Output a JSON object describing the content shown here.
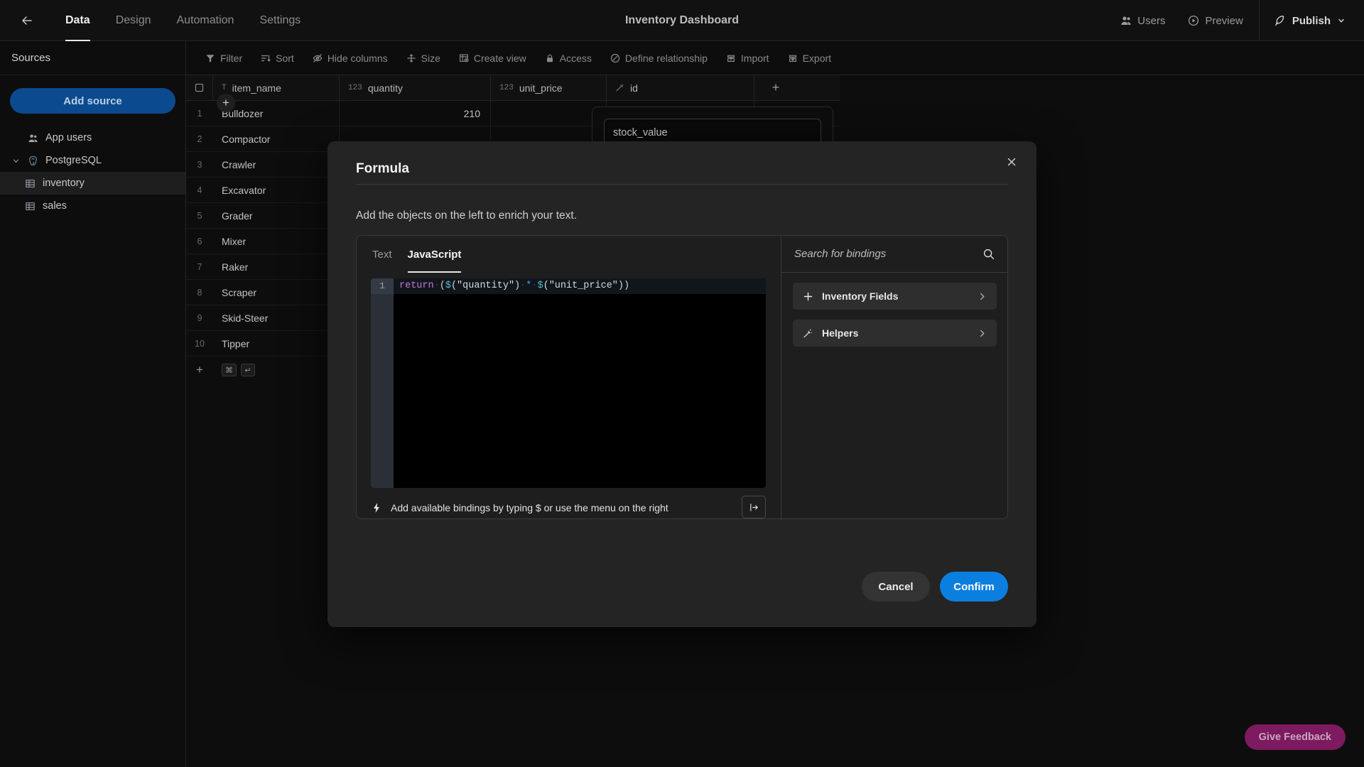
{
  "header": {
    "back_icon": "arrow-left-icon",
    "tabs": [
      {
        "label": "Data",
        "active": true
      },
      {
        "label": "Design",
        "active": false
      },
      {
        "label": "Automation",
        "active": false
      },
      {
        "label": "Settings",
        "active": false
      }
    ],
    "title": "Inventory Dashboard",
    "users_label": "Users",
    "preview_label": "Preview",
    "publish_label": "Publish"
  },
  "sidebar": {
    "section_label": "Sources",
    "add_source_label": "Add source",
    "items": [
      {
        "label": "App users",
        "icon": "users-icon",
        "selected": false
      },
      {
        "label": "PostgreSQL",
        "icon": "postgres-icon",
        "selected": false
      },
      {
        "label": "inventory",
        "icon": "table-icon",
        "selected": true
      },
      {
        "label": "sales",
        "icon": "table-icon",
        "selected": false
      }
    ]
  },
  "toolbar": {
    "items": [
      {
        "label": "Filter",
        "icon": "filter-icon"
      },
      {
        "label": "Sort",
        "icon": "sort-icon"
      },
      {
        "label": "Hide columns",
        "icon": "eye-off-icon"
      },
      {
        "label": "Size",
        "icon": "row-height-icon"
      },
      {
        "label": "Create view",
        "icon": "create-view-icon"
      },
      {
        "label": "Access",
        "icon": "lock-icon"
      },
      {
        "label": "Define relationship",
        "icon": "relationship-icon"
      },
      {
        "label": "Import",
        "icon": "import-icon"
      },
      {
        "label": "Export",
        "icon": "export-icon"
      }
    ]
  },
  "grid": {
    "columns": [
      {
        "label": "item_name",
        "type_icon": "text-icon",
        "type_glyph": "T"
      },
      {
        "label": "quantity",
        "type_icon": "number-icon",
        "type_glyph": "123"
      },
      {
        "label": "unit_price",
        "type_icon": "number-icon",
        "type_glyph": "123"
      },
      {
        "label": "id",
        "type_icon": "formula-icon",
        "type_glyph": ""
      }
    ],
    "add_column_label": "+",
    "rows": [
      {
        "index": "1",
        "item_name": "Bulldozer",
        "quantity": "210",
        "unit_price": "",
        "id": ""
      },
      {
        "index": "2",
        "item_name": "Compactor",
        "quantity": "",
        "unit_price": "",
        "id": ""
      },
      {
        "index": "3",
        "item_name": "Crawler",
        "quantity": "",
        "unit_price": "",
        "id": ""
      },
      {
        "index": "4",
        "item_name": "Excavator",
        "quantity": "",
        "unit_price": "",
        "id": ""
      },
      {
        "index": "5",
        "item_name": "Grader",
        "quantity": "",
        "unit_price": "",
        "id": ""
      },
      {
        "index": "6",
        "item_name": "Mixer",
        "quantity": "",
        "unit_price": "",
        "id": ""
      },
      {
        "index": "7",
        "item_name": "Raker",
        "quantity": "",
        "unit_price": "",
        "id": ""
      },
      {
        "index": "8",
        "item_name": "Scraper",
        "quantity": "",
        "unit_price": "",
        "id": ""
      },
      {
        "index": "9",
        "item_name": "Skid-Steer",
        "quantity": "",
        "unit_price": "",
        "id": ""
      },
      {
        "index": "10",
        "item_name": "Tipper",
        "quantity": "",
        "unit_price": "",
        "id": ""
      }
    ],
    "new_row": {
      "plus": "+",
      "kbd_cmd": "⌘",
      "kbd_enter": "↵"
    }
  },
  "column_popover": {
    "name_value": "stock_value"
  },
  "modal": {
    "title": "Formula",
    "close_icon": "close-icon",
    "subtitle": "Add the objects on the left to enrich your text.",
    "tabs": [
      {
        "label": "Text",
        "active": false
      },
      {
        "label": "JavaScript",
        "active": true
      }
    ],
    "editor": {
      "line_number": "1",
      "code": "return ($(\"quantity\") * $(\"unit_price\"))",
      "tokens": {
        "kw": "return",
        "dot1": "·",
        "open_paren": "(",
        "dollar1": "$",
        "str1": "(\"quantity\")",
        "dot2": "·",
        "op": "*",
        "dot3": "·",
        "dollar2": "$",
        "str2": "(\"unit_price\"))"
      },
      "colors": {
        "keyword": "#c678dd",
        "dollar": "#56b6c2",
        "string": "#d6dae0",
        "operator": "#4a9ee8",
        "punct": "#c8cdd4",
        "background": "#000000",
        "gutter": "#2b3038"
      }
    },
    "hint": {
      "icon": "lightning-icon",
      "text": "Add available bindings by typing $ or use the menu on the right",
      "expand_icon": "expand-right-icon"
    },
    "bindings": {
      "search_placeholder": "Search for bindings",
      "search_value": "",
      "search_icon": "search-icon",
      "items": [
        {
          "label": "Inventory Fields",
          "icon": "plus-icon",
          "chevron": "›"
        },
        {
          "label": "Helpers",
          "icon": "magic-wand-icon",
          "chevron": "›"
        }
      ]
    },
    "cancel_label": "Cancel",
    "confirm_label": "Confirm",
    "accent_confirm": "#0b7fe0"
  },
  "feedback": {
    "label": "Give Feedback",
    "color": "#7d1a60"
  }
}
